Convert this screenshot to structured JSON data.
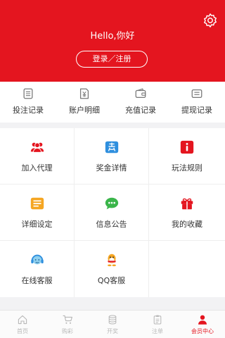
{
  "header": {
    "greeting": "Hello,你好",
    "login_label": "登录／注册",
    "settings_icon": "gear-icon",
    "background": "#e4151f"
  },
  "quick_links": [
    {
      "label": "投注记录",
      "icon": "document-icon"
    },
    {
      "label": "账户明细",
      "icon": "yuan-note-icon"
    },
    {
      "label": "充值记录",
      "icon": "wallet-icon"
    },
    {
      "label": "提现记录",
      "icon": "card-icon"
    }
  ],
  "menu": [
    {
      "label": "加入代理",
      "icon": "users-icon",
      "color": "#e4151f"
    },
    {
      "label": "奖金详情",
      "icon": "reward-icon",
      "color": "#2f8fde"
    },
    {
      "label": "玩法规则",
      "icon": "info-icon",
      "color": "#e4151f"
    },
    {
      "label": "详细设定",
      "icon": "settings-list-icon",
      "color": "#f5a623"
    },
    {
      "label": "信息公告",
      "icon": "chat-icon",
      "color": "#3ab54a"
    },
    {
      "label": "我的收藏",
      "icon": "gift-icon",
      "color": "#e4151f"
    },
    {
      "label": "在线客服",
      "icon": "headset-icon",
      "color": "#2f8fde"
    },
    {
      "label": "QQ客服",
      "icon": "qq-icon",
      "color": "#f5a623"
    }
  ],
  "tabbar": [
    {
      "label": "首页",
      "icon": "home-icon",
      "active": false
    },
    {
      "label": "购彩",
      "icon": "cart-icon",
      "active": false
    },
    {
      "label": "开奖",
      "icon": "database-icon",
      "active": false
    },
    {
      "label": "注单",
      "icon": "clipboard-icon",
      "active": false
    },
    {
      "label": "会员中心",
      "icon": "user-icon",
      "active": true
    }
  ]
}
